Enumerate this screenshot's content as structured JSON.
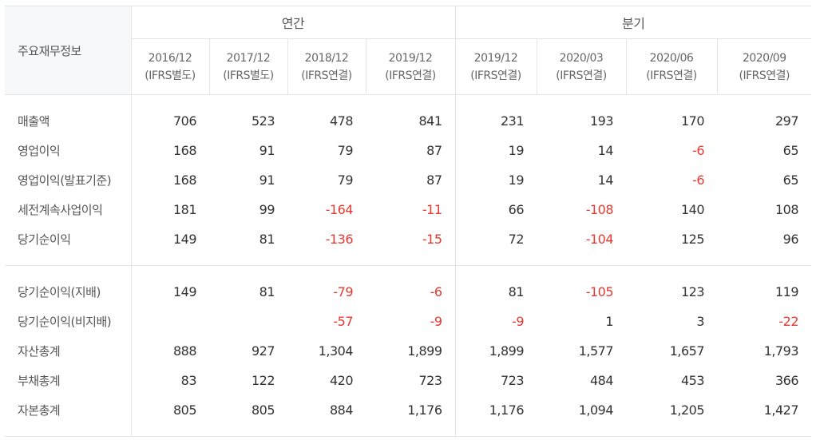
{
  "table": {
    "title": "주요재무정보",
    "groups": {
      "annual": "연간",
      "quarterly": "분기"
    },
    "periods": [
      {
        "date": "2016/12",
        "basis": "(IFRS별도)"
      },
      {
        "date": "2017/12",
        "basis": "(IFRS별도)"
      },
      {
        "date": "2018/12",
        "basis": "(IFRS연결)"
      },
      {
        "date": "2019/12",
        "basis": "(IFRS연결)"
      },
      {
        "date": "2019/12",
        "basis": "(IFRS연결)"
      },
      {
        "date": "2020/03",
        "basis": "(IFRS연결)"
      },
      {
        "date": "2020/06",
        "basis": "(IFRS연결)"
      },
      {
        "date": "2020/09",
        "basis": "(IFRS연결)"
      }
    ],
    "rows": [
      {
        "label": "매출액",
        "values": [
          "706",
          "523",
          "478",
          "841",
          "231",
          "193",
          "170",
          "297"
        ]
      },
      {
        "label": "영업이익",
        "values": [
          "168",
          "91",
          "79",
          "87",
          "19",
          "14",
          "-6",
          "65"
        ]
      },
      {
        "label": "영업이익(발표기준)",
        "values": [
          "168",
          "91",
          "79",
          "87",
          "19",
          "14",
          "-6",
          "65"
        ]
      },
      {
        "label": "세전계속사업이익",
        "values": [
          "181",
          "99",
          "-164",
          "-11",
          "66",
          "-108",
          "140",
          "108"
        ]
      },
      {
        "label": "당기순이익",
        "values": [
          "149",
          "81",
          "-136",
          "-15",
          "72",
          "-104",
          "125",
          "96"
        ]
      },
      {
        "label": "당기순이익(지배)",
        "values": [
          "149",
          "81",
          "-79",
          "-6",
          "81",
          "-105",
          "123",
          "119"
        ]
      },
      {
        "label": "당기순이익(비지배)",
        "values": [
          "",
          "",
          "-57",
          "-9",
          "-9",
          "1",
          "3",
          "-22"
        ]
      },
      {
        "label": "자산총계",
        "values": [
          "888",
          "927",
          "1,304",
          "1,899",
          "1,899",
          "1,577",
          "1,657",
          "1,793"
        ]
      },
      {
        "label": "부채총계",
        "values": [
          "83",
          "122",
          "420",
          "723",
          "723",
          "484",
          "453",
          "366"
        ]
      },
      {
        "label": "자본총계",
        "values": [
          "805",
          "805",
          "884",
          "1,176",
          "1,176",
          "1,094",
          "1,205",
          "1,427"
        ]
      }
    ],
    "colors": {
      "negative": "#e8382f",
      "header_bg": "#f7f8fa",
      "border": "#e5e5e5"
    }
  }
}
